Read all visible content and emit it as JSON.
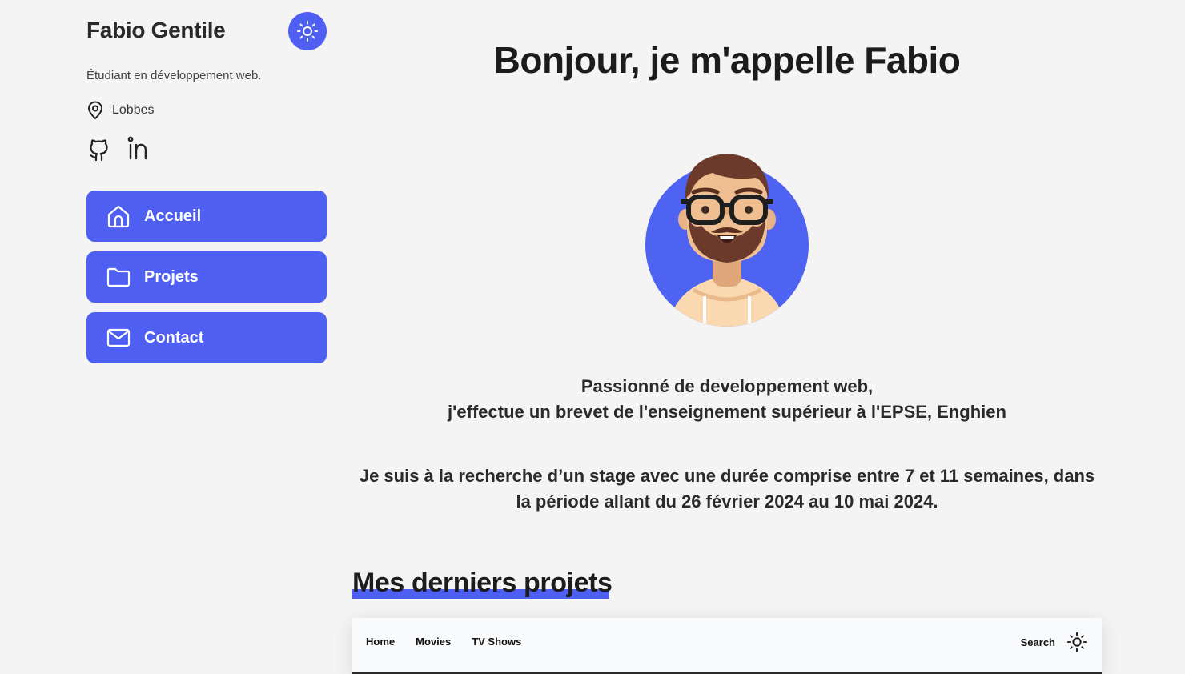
{
  "profile": {
    "name": "Fabio Gentile",
    "subtitle": "Étudiant en développement web.",
    "location": "Lobbes"
  },
  "socials": [
    {
      "icon": "github-icon"
    },
    {
      "icon": "linkedin-icon"
    }
  ],
  "nav": {
    "home": "Accueil",
    "projects": "Projets",
    "contact": "Contact"
  },
  "main": {
    "greeting": "Bonjour, je m'appelle Fabio",
    "intro_line1": "Passionné de developpement web,",
    "intro_line2": "j'effectue un brevet de l'enseignement supérieur à l'EPSE, Enghien",
    "internship": "Je suis à la recherche d’un stage avec une durée comprise entre 7 et 11 semaines, dans la période allant du 26 février 2024 au 10 mai 2024.",
    "projects_title": "Mes derniers projets"
  },
  "preview": {
    "links": [
      "Home",
      "Movies",
      "TV Shows"
    ],
    "search": "Search"
  },
  "colors": {
    "accent": "#4f5ff2",
    "background": "#f4f4f4",
    "text": "#1c1c1c"
  }
}
